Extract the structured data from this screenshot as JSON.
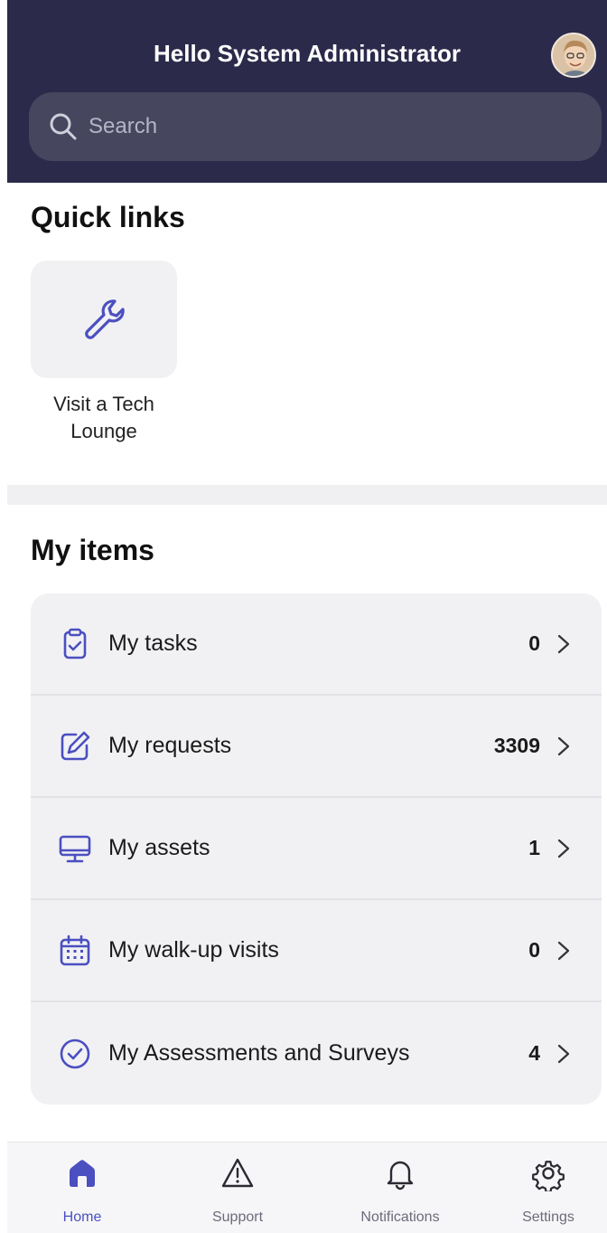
{
  "header": {
    "greeting": "Hello System Administrator"
  },
  "search": {
    "placeholder": "Search"
  },
  "quick_links": {
    "title": "Quick links",
    "items": [
      {
        "label_line1": "Visit a Tech",
        "label_line2": "Lounge",
        "icon": "wrench-icon"
      }
    ]
  },
  "my_items": {
    "title": "My items",
    "rows": [
      {
        "label": "My tasks",
        "count": "0",
        "icon": "clipboard-check-icon"
      },
      {
        "label": "My requests",
        "count": "3309",
        "icon": "edit-icon"
      },
      {
        "label": "My assets",
        "count": "1",
        "icon": "monitor-icon"
      },
      {
        "label": "My walk-up visits",
        "count": "0",
        "icon": "calendar-icon"
      },
      {
        "label": "My Assessments and Surveys",
        "count": "4",
        "icon": "check-circle-icon"
      }
    ]
  },
  "bottom_nav": {
    "items": [
      {
        "label": "Home",
        "icon": "home-icon",
        "active": true
      },
      {
        "label": "Support",
        "icon": "warning-icon",
        "active": false
      },
      {
        "label": "Notifications",
        "icon": "bell-icon",
        "active": false
      },
      {
        "label": "Settings",
        "icon": "gear-icon",
        "active": false
      }
    ]
  },
  "colors": {
    "header_bg": "#2b2a4a",
    "accent": "#4b4fc0",
    "card_bg": "#f1f1f4"
  }
}
